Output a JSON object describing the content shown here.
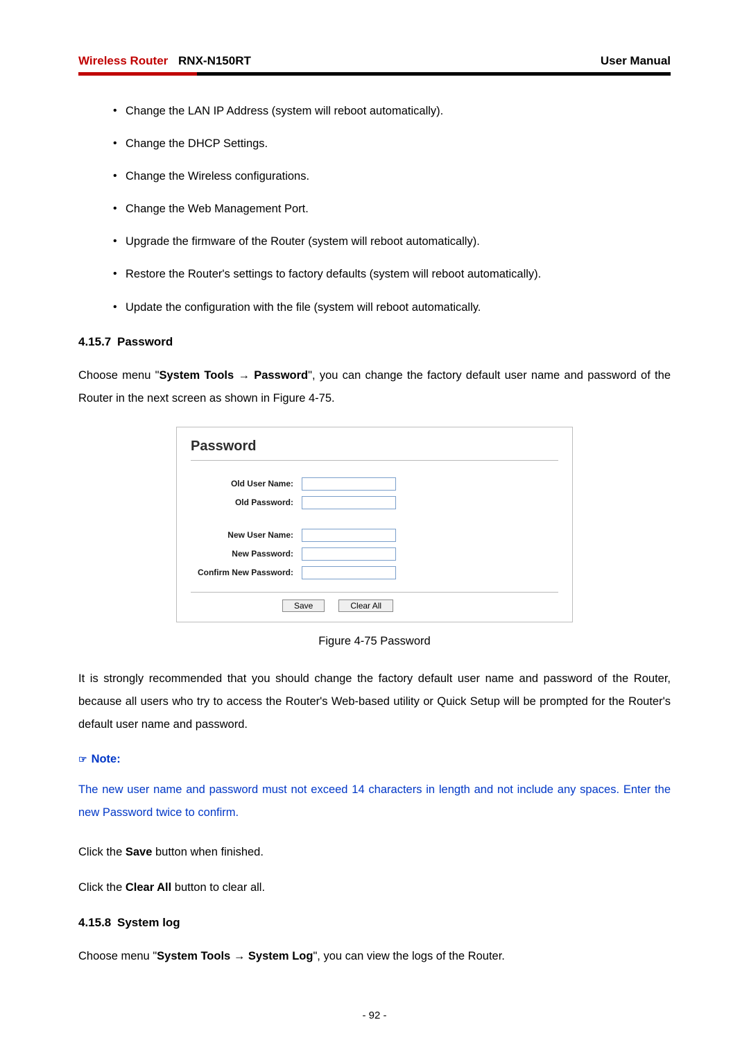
{
  "header": {
    "product_red": "Wireless Router",
    "product_model": "RNX-N150RT",
    "right": "User Manual"
  },
  "bullets": [
    "Change the LAN IP Address (system will reboot automatically).",
    "Change the DHCP Settings.",
    "Change the Wireless configurations.",
    "Change the Web Management Port.",
    "Upgrade the firmware of the Router (system will reboot automatically).",
    "Restore the Router's settings to factory defaults (system will reboot automatically).",
    "Update the configuration with the file (system will reboot automatically."
  ],
  "section1": {
    "num": "4.15.7",
    "title": "Password",
    "choose_prefix": "Choose menu \"",
    "choose_bold1": "System Tools",
    "choose_arrow": " → ",
    "choose_bold2": "Password",
    "choose_suffix": "\", you can change the factory default user name and password of the Router in the next screen as shown in Figure 4-75."
  },
  "panel": {
    "title": "Password",
    "labels": {
      "old_user": "Old User Name:",
      "old_pass": "Old Password:",
      "new_user": "New User Name:",
      "new_pass": "New Password:",
      "confirm": "Confirm New Password:"
    },
    "values": {
      "old_user": "",
      "old_pass": "",
      "new_user": "",
      "new_pass": "",
      "confirm": ""
    },
    "buttons": {
      "save": "Save",
      "clear": "Clear All"
    }
  },
  "figure_caption": "Figure 4-75    Password",
  "para_recommend": "It is strongly recommended that you should change the factory default user name and password of the Router, because all users who try to access the Router's Web-based utility or Quick Setup will be prompted for the Router's default user name and password.",
  "note_label": "Note:",
  "note_body": "The new user name and password must not exceed 14 characters in length and not include any spaces. Enter the new Password twice to confirm.",
  "click_save_prefix": "Click the ",
  "click_save_bold": "Save",
  "click_save_suffix": " button when finished.",
  "click_clear_prefix": "Click the ",
  "click_clear_bold": "Clear All",
  "click_clear_suffix": " button to clear all.",
  "section2": {
    "num": "4.15.8",
    "title": "System log",
    "choose_prefix": "Choose menu \"",
    "choose_bold1": "System Tools",
    "choose_arrow": " → ",
    "choose_bold2": "System Log",
    "choose_suffix": "\", you can view the logs of the Router."
  },
  "page_number": "- 92 -"
}
